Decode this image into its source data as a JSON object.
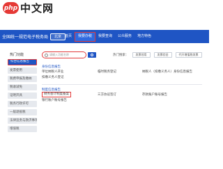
{
  "watermark": {
    "logo": "php",
    "text": "中文网"
  },
  "header": {
    "site_title": "全国统一规范电子税务局",
    "region": "北京",
    "nav": [
      "首页",
      "我要办税",
      "我要查询",
      "公众服务",
      "地方特色"
    ]
  },
  "sidebar": {
    "heading": "热门功能",
    "items": [
      "综合信息报告",
      "发票使用",
      "税费申报及缴纳",
      "税收减免",
      "证明开具",
      "税务行政许可",
      "一般退抵税",
      "法律追责与救济事项",
      "增值税"
    ]
  },
  "search": {
    "placeholder": "请输入功能名称",
    "hot_label": "热门搜索：",
    "chips": [
      "发票领用",
      "发票验旧",
      "代开增值税发票"
    ]
  },
  "sections": [
    {
      "title": "身份信息报告",
      "rows": [
        [
          "单位纳税人开业",
          "临时税务登记",
          "纳税人（扣缴义务人）身份信息报告"
        ],
        [
          "扣缴义务人登记",
          "",
          ""
        ]
      ]
    },
    {
      "title": "制度信息报告",
      "rows": [
        [
          "财务会计制度备案",
          "三方协议签订",
          "存款账户账号报告"
        ],
        [
          "银行账户账号报告",
          "",
          ""
        ]
      ]
    }
  ]
}
